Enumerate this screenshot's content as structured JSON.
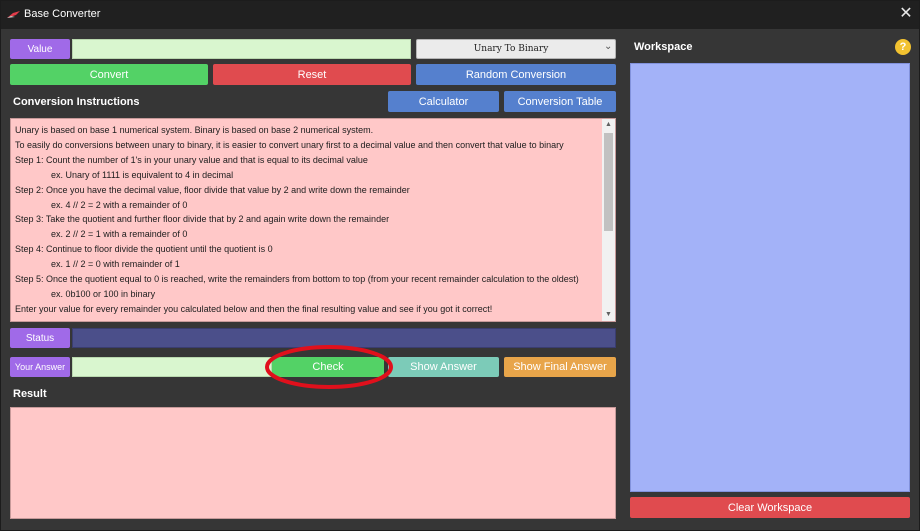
{
  "window": {
    "title": "Base Converter",
    "close_glyph": "✕"
  },
  "value_row": {
    "label": "Value",
    "input_value": "",
    "mode_select": {
      "selected": "Unary To Binary",
      "arrow": "⌄"
    }
  },
  "actions": {
    "convert": "Convert",
    "reset": "Reset",
    "random": "Random Conversion"
  },
  "instructions_header": {
    "title": "Conversion Instructions",
    "calculator": "Calculator",
    "conversion_table": "Conversion Table"
  },
  "instructions": {
    "lines": [
      "Unary is based on base 1 numerical system. Binary is based on base 2 numerical system.",
      "To easily do conversions between unary to binary, it is easier to convert unary first to a decimal value and then convert that value to binary",
      "Step 1: Count the number of 1's in your unary value and that is equal to its decimal value",
      "ex. Unary of 1111 is equivalent to 4 in decimal",
      "Step 2: Once you have the decimal value, floor divide that value by 2 and write down the remainder",
      "ex. 4 // 2 = 2 with a remainder of 0",
      "Step 3: Take the quotient and further floor divide that by 2 and again write down the remainder",
      "ex. 2 // 2 = 1 with a remainder of 0",
      "Step 4: Continue to floor divide the quotient until the quotient is 0",
      "ex. 1 // 2 = 0 with remainder of 1",
      "Step 5: Once the quotient equal to 0 is reached, write the remainders from bottom to top (from your recent remainder calculation to the oldest)",
      "ex. 0b100 or 100 in binary",
      "Enter your value for every remainder you calculated below and then the final resulting value and see if you got it correct!"
    ],
    "scroll_up_glyph": "▲",
    "scroll_down_glyph": "▼"
  },
  "status": {
    "label": "Status",
    "value": ""
  },
  "answer_row": {
    "label": "Your Answer",
    "input_value": "",
    "check": "Check",
    "show_answer": "Show Answer",
    "show_final_answer": "Show Final Answer"
  },
  "result": {
    "title": "Result",
    "value": ""
  },
  "workspace": {
    "title": "Workspace",
    "help_icon": "?",
    "clear": "Clear Workspace"
  },
  "colors": {
    "purple_tag": "#a06ae8",
    "input_green": "#d9f6cf",
    "convert_green": "#53d266",
    "reset_red": "#e04b4f",
    "blue_button": "#5580ce",
    "instructions_bg": "#ffc8c8",
    "status_field": "#4b4f8a",
    "teal_button": "#7ccbb8",
    "orange_button": "#e8a54a",
    "workspace_bg": "#a3b2f8",
    "annotation_red": "#e0101c",
    "help_yellow": "#f2c230"
  }
}
